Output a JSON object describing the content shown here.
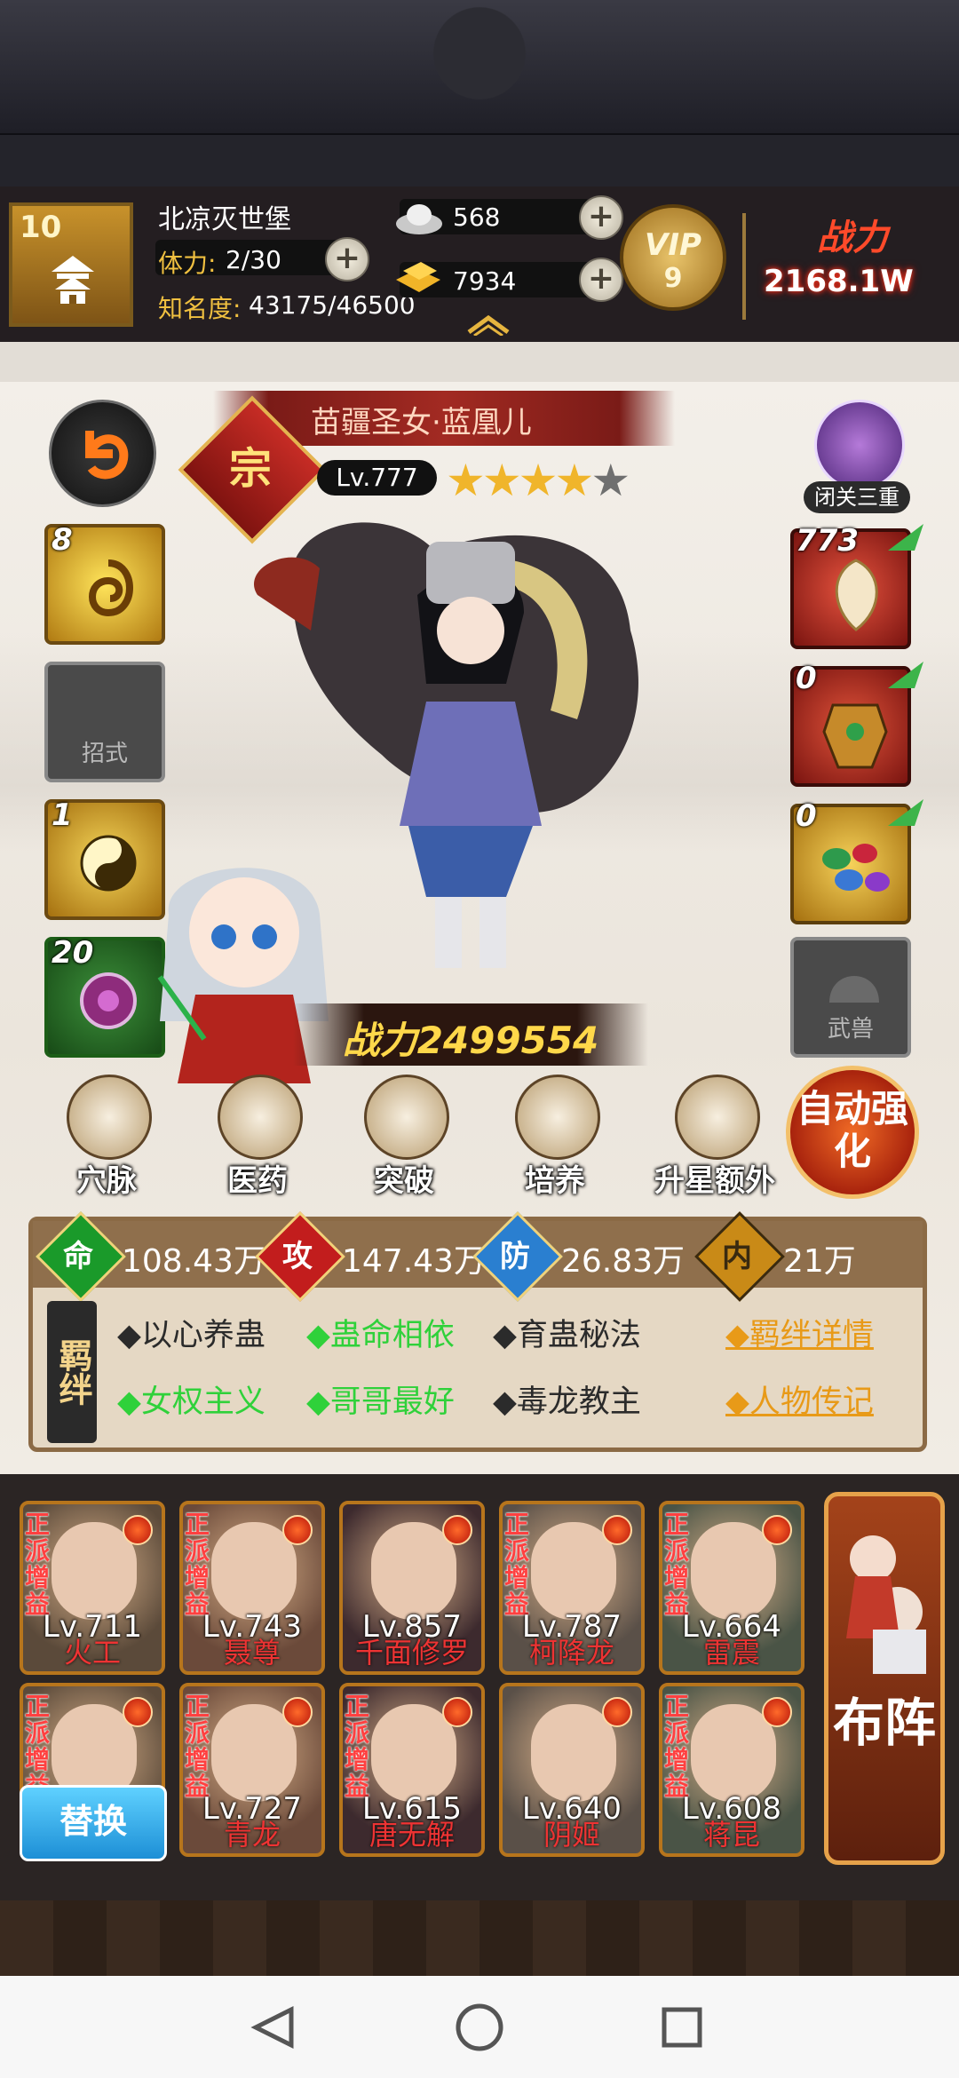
{
  "header": {
    "player_level": "10",
    "player_name": "北凉灭世堡",
    "stamina_label": "体力:",
    "stamina_value": "2/30",
    "fame_label": "知名度:",
    "fame_value": "43175/46500",
    "silver": "568",
    "gold": "7934",
    "vip_text": "VIP",
    "vip_level": "9",
    "power_label": "战力",
    "power_value": "2168.1W"
  },
  "hero": {
    "name": "苗疆圣女·蓝凰儿",
    "quality": "宗",
    "level": "Lv.777",
    "stars": 4,
    "stars_max": 5,
    "battle_power": "战力2499554"
  },
  "left_skills": [
    {
      "name": "skill-1",
      "count": "8",
      "label": ""
    },
    {
      "name": "skill-2",
      "count": "",
      "label": "招式"
    },
    {
      "name": "skill-3",
      "count": "1",
      "label": ""
    },
    {
      "name": "skill-4",
      "count": "20",
      "label": ""
    }
  ],
  "closed_door": {
    "label": "闭关三重"
  },
  "right_equips": [
    {
      "count": "773",
      "label": ""
    },
    {
      "count": "0",
      "label": ""
    },
    {
      "count": "0",
      "label": ""
    },
    {
      "count": "",
      "label": "武兽"
    }
  ],
  "functions": [
    "穴脉",
    "医药",
    "突破",
    "培养",
    "升星额外"
  ],
  "auto_button": "自动强化",
  "stats": [
    {
      "char": "命",
      "value": "108.43万",
      "color": "#1a9a2a"
    },
    {
      "char": "攻",
      "value": "147.43万",
      "color": "#c21d1d"
    },
    {
      "char": "防",
      "value": "26.83万",
      "color": "#2a7fd0"
    },
    {
      "char": "内",
      "value": "21万",
      "color": "#c98a17"
    }
  ],
  "bond_tag": "羁绊",
  "bonds": [
    {
      "text": "◆以心养蛊",
      "active": false
    },
    {
      "text": "◆蛊命相依",
      "active": true
    },
    {
      "text": "◆育蛊秘法",
      "active": false
    },
    {
      "text": "◆女权主义",
      "active": true
    },
    {
      "text": "◆哥哥最好",
      "active": true
    },
    {
      "text": "◆毒龙教主",
      "active": false
    }
  ],
  "bond_links": [
    "◆羁绊详情",
    "◆人物传记"
  ],
  "roster_row1": [
    {
      "tag": "正派增益",
      "lv": "Lv.711",
      "name": "火工"
    },
    {
      "tag": "正派增益",
      "lv": "Lv.743",
      "name": "聂尊"
    },
    {
      "tag": "",
      "lv": "Lv.857",
      "name": "千面修罗"
    },
    {
      "tag": "正派增益",
      "lv": "Lv.787",
      "name": "柯降龙"
    },
    {
      "tag": "正派增益",
      "lv": "Lv.664",
      "name": "雷震"
    }
  ],
  "roster_row2": [
    {
      "tag": "正派增益",
      "lv": "",
      "name": ""
    },
    {
      "tag": "正派增益",
      "lv": "Lv.727",
      "name": "青龙"
    },
    {
      "tag": "正派增益",
      "lv": "Lv.615",
      "name": "唐无解"
    },
    {
      "tag": "",
      "lv": "Lv.640",
      "name": "阴姬"
    },
    {
      "tag": "正派增益",
      "lv": "Lv.608",
      "name": "蒋昆"
    }
  ],
  "swap_button": "替换",
  "formation_button": "布阵"
}
